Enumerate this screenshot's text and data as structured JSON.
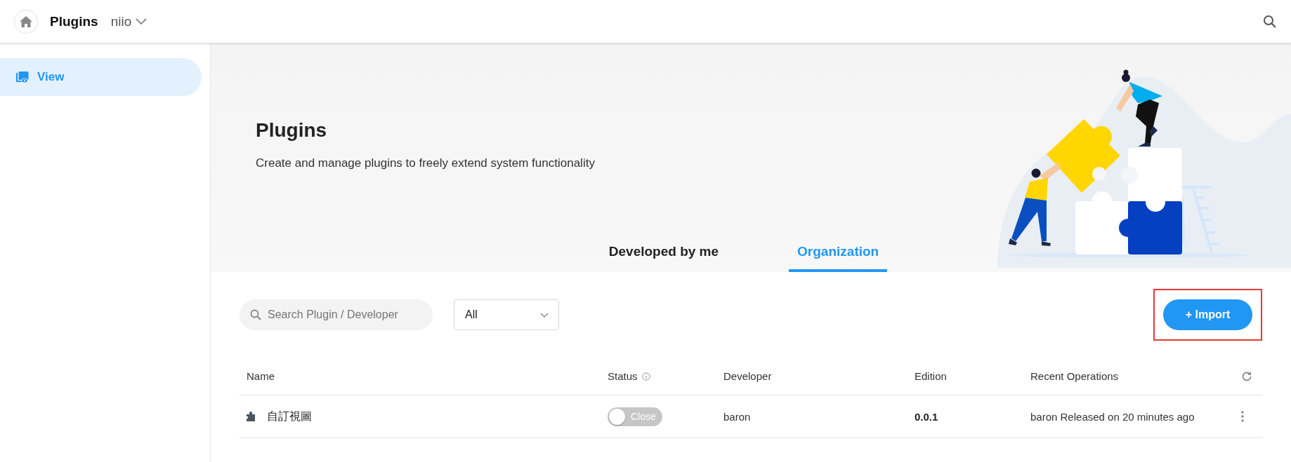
{
  "header": {
    "title": "Plugins",
    "workspace": "niio"
  },
  "sidebar": {
    "items": [
      {
        "label": "View",
        "selected": true
      }
    ]
  },
  "hero": {
    "title": "Plugins",
    "subtitle": "Create and manage plugins to freely extend system functionality"
  },
  "tabs": [
    {
      "label": "Developed by me",
      "selected": false
    },
    {
      "label": "Organization",
      "selected": true
    }
  ],
  "toolbar": {
    "search": {
      "placeholder": "Search Plugin / Developer"
    },
    "filter": {
      "value": "All"
    },
    "import_button": {
      "label": "+ Import",
      "highlighted": true
    }
  },
  "table": {
    "columns": [
      {
        "label": "Name",
        "info": false
      },
      {
        "label": "Status",
        "info": true
      },
      {
        "label": "Developer",
        "info": false
      },
      {
        "label": "Edition",
        "info": false
      },
      {
        "label": "Recent Operations",
        "info": false
      }
    ],
    "rows": [
      {
        "name": "自訂視圖",
        "status": {
          "on": false,
          "label": "Close"
        },
        "developer": "baron",
        "edition": "0.0.1",
        "recent_operations": "baron Released on 20 minutes ago"
      }
    ]
  }
}
